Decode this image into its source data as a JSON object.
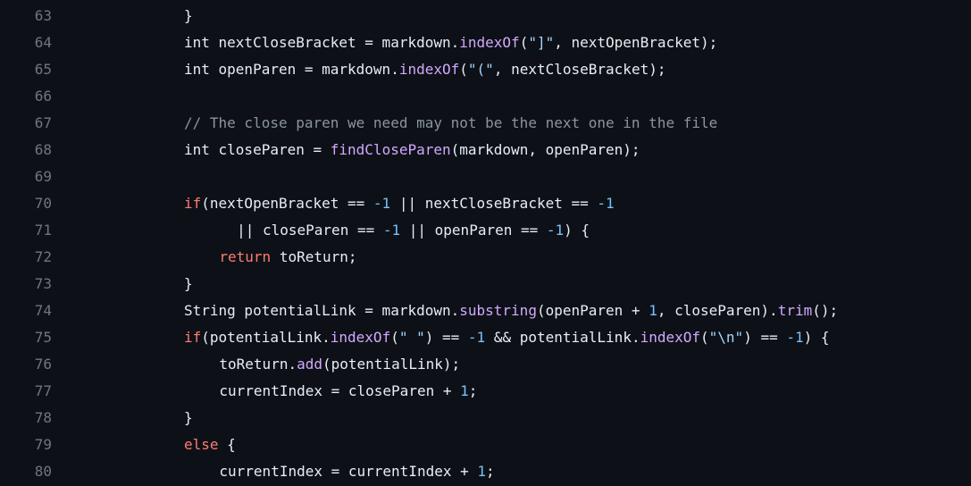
{
  "colors": {
    "background": "#0d1117",
    "line_number": "#6e7681",
    "plain": "#e6edf3",
    "keyword": "#ff7b72",
    "function": "#d2a8ff",
    "string": "#a5d6ff",
    "number": "#79c0ff",
    "comment": "#8b949e"
  },
  "code": {
    "lines": [
      {
        "number": "63",
        "indent": 0,
        "tokens": [
          {
            "t": "plain",
            "s": "}"
          }
        ]
      },
      {
        "number": "64",
        "indent": 0,
        "tokens": [
          {
            "t": "plain",
            "s": "int nextCloseBracket = markdown."
          },
          {
            "t": "func",
            "s": "indexOf"
          },
          {
            "t": "plain",
            "s": "("
          },
          {
            "t": "string",
            "s": "\"]\""
          },
          {
            "t": "plain",
            "s": ", nextOpenBracket);"
          }
        ]
      },
      {
        "number": "65",
        "indent": 0,
        "tokens": [
          {
            "t": "plain",
            "s": "int openParen = markdown."
          },
          {
            "t": "func",
            "s": "indexOf"
          },
          {
            "t": "plain",
            "s": "("
          },
          {
            "t": "string",
            "s": "\"(\""
          },
          {
            "t": "plain",
            "s": ", nextCloseBracket);"
          }
        ]
      },
      {
        "number": "66",
        "indent": 0,
        "tokens": []
      },
      {
        "number": "67",
        "indent": 0,
        "tokens": [
          {
            "t": "comment",
            "s": "// The close paren we need may not be the next one in the file"
          }
        ]
      },
      {
        "number": "68",
        "indent": 0,
        "tokens": [
          {
            "t": "plain",
            "s": "int closeParen = "
          },
          {
            "t": "func",
            "s": "findCloseParen"
          },
          {
            "t": "plain",
            "s": "(markdown, openParen);"
          }
        ]
      },
      {
        "number": "69",
        "indent": 0,
        "tokens": []
      },
      {
        "number": "70",
        "indent": 0,
        "tokens": [
          {
            "t": "keyword",
            "s": "if"
          },
          {
            "t": "plain",
            "s": "(nextOpenBracket == "
          },
          {
            "t": "number",
            "s": "-1"
          },
          {
            "t": "plain",
            "s": " || nextCloseBracket == "
          },
          {
            "t": "number",
            "s": "-1"
          }
        ]
      },
      {
        "number": "71",
        "indent": 6,
        "tokens": [
          {
            "t": "plain",
            "s": "|| closeParen == "
          },
          {
            "t": "number",
            "s": "-1"
          },
          {
            "t": "plain",
            "s": " || openParen == "
          },
          {
            "t": "number",
            "s": "-1"
          },
          {
            "t": "plain",
            "s": ") {"
          }
        ]
      },
      {
        "number": "72",
        "indent": 4,
        "tokens": [
          {
            "t": "keyword",
            "s": "return"
          },
          {
            "t": "plain",
            "s": " toReturn;"
          }
        ]
      },
      {
        "number": "73",
        "indent": 0,
        "tokens": [
          {
            "t": "plain",
            "s": "}"
          }
        ]
      },
      {
        "number": "74",
        "indent": 0,
        "tokens": [
          {
            "t": "plain",
            "s": "String potentialLink = markdown."
          },
          {
            "t": "func",
            "s": "substring"
          },
          {
            "t": "plain",
            "s": "(openParen + "
          },
          {
            "t": "number",
            "s": "1"
          },
          {
            "t": "plain",
            "s": ", closeParen)."
          },
          {
            "t": "func",
            "s": "trim"
          },
          {
            "t": "plain",
            "s": "();"
          }
        ]
      },
      {
        "number": "75",
        "indent": 0,
        "tokens": [
          {
            "t": "keyword",
            "s": "if"
          },
          {
            "t": "plain",
            "s": "(potentialLink."
          },
          {
            "t": "func",
            "s": "indexOf"
          },
          {
            "t": "plain",
            "s": "("
          },
          {
            "t": "string",
            "s": "\" \""
          },
          {
            "t": "plain",
            "s": ") == "
          },
          {
            "t": "number",
            "s": "-1"
          },
          {
            "t": "plain",
            "s": " && potentialLink."
          },
          {
            "t": "func",
            "s": "indexOf"
          },
          {
            "t": "plain",
            "s": "("
          },
          {
            "t": "string",
            "s": "\"\\n\""
          },
          {
            "t": "plain",
            "s": ") == "
          },
          {
            "t": "number",
            "s": "-1"
          },
          {
            "t": "plain",
            "s": ") {"
          }
        ]
      },
      {
        "number": "76",
        "indent": 4,
        "tokens": [
          {
            "t": "plain",
            "s": "toReturn."
          },
          {
            "t": "func",
            "s": "add"
          },
          {
            "t": "plain",
            "s": "(potentialLink);"
          }
        ]
      },
      {
        "number": "77",
        "indent": 4,
        "tokens": [
          {
            "t": "plain",
            "s": "currentIndex = closeParen + "
          },
          {
            "t": "number",
            "s": "1"
          },
          {
            "t": "plain",
            "s": ";"
          }
        ]
      },
      {
        "number": "78",
        "indent": 0,
        "tokens": [
          {
            "t": "plain",
            "s": "}"
          }
        ]
      },
      {
        "number": "79",
        "indent": 0,
        "tokens": [
          {
            "t": "keyword",
            "s": "else"
          },
          {
            "t": "plain",
            "s": " {"
          }
        ]
      },
      {
        "number": "80",
        "indent": 4,
        "tokens": [
          {
            "t": "plain",
            "s": "currentIndex = currentIndex + "
          },
          {
            "t": "number",
            "s": "1"
          },
          {
            "t": "plain",
            "s": ";"
          }
        ]
      }
    ]
  }
}
